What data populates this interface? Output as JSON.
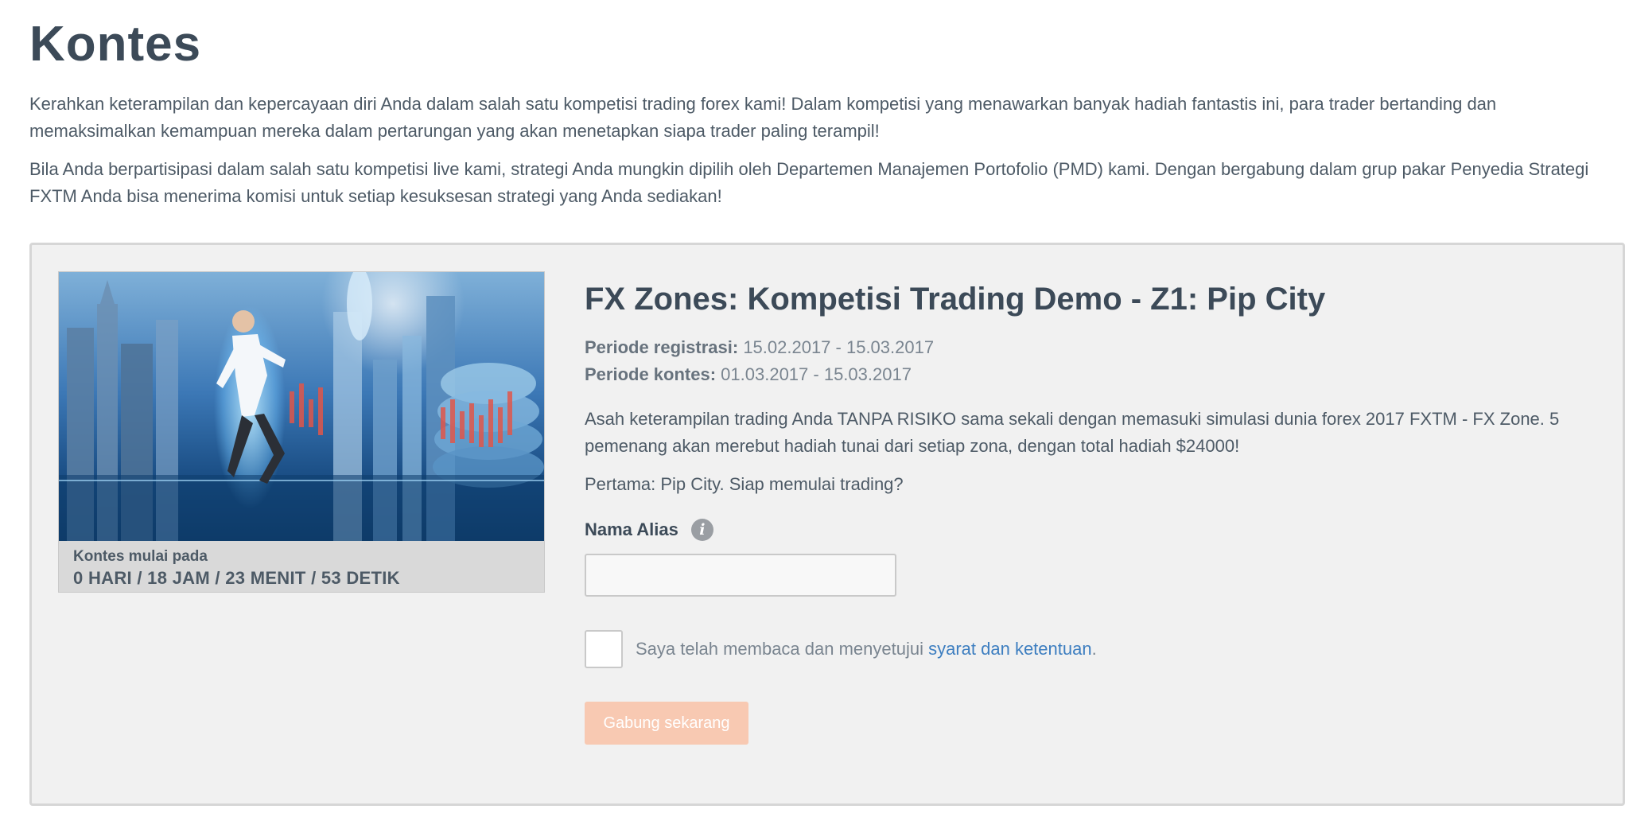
{
  "page": {
    "title": "Kontes",
    "intro_paragraphs": [
      "Kerahkan keterampilan dan kepercayaan diri Anda dalam salah satu kompetisi trading forex kami! Dalam kompetisi yang menawarkan banyak hadiah fantastis ini, para trader bertanding dan memaksimalkan kemampuan mereka dalam pertarungan yang akan menetapkan siapa trader paling terampil!",
      "Bila Anda berpartisipasi dalam salah satu kompetisi live kami, strategi Anda mungkin dipilih oleh Departemen Manajemen Portofolio (PMD) kami. Dengan bergabung dalam grup pakar Penyedia Strategi FXTM Anda bisa menerima komisi untuk setiap kesuksesan strategi yang Anda sediakan!"
    ]
  },
  "contest": {
    "banner": {
      "countdown_label": "Kontes mulai pada",
      "countdown_value": "0 HARI / 18 JAM / 23 MENIT / 53 DETIK"
    },
    "title": "FX Zones: Kompetisi Trading Demo - Z1: Pip City",
    "registration_label": "Periode registrasi:",
    "registration_value": "15.02.2017 - 15.03.2017",
    "contest_period_label": "Periode kontes:",
    "contest_period_value": "01.03.2017 - 15.03.2017",
    "description": [
      "Asah keterampilan trading Anda TANPA RISIKO sama sekali dengan memasuki simulasi dunia forex 2017 FXTM - FX Zone. 5 pemenang akan merebut hadiah tunai dari setiap zona, dengan total hadiah $24000!",
      "Pertama: Pip City. Siap memulai trading?"
    ],
    "alias_label": "Nama Alias",
    "info_icon_glyph": "i",
    "alias_value": "",
    "alias_placeholder": "",
    "agree_text": "Saya telah membaca dan menyetujui ",
    "agree_link": "syarat dan ketentuan",
    "agree_suffix": ".",
    "agree_checked": false,
    "join_button": "Gabung sekarang"
  },
  "colors": {
    "heading": "#3c4a58",
    "body_text": "#4d5a66",
    "muted_text": "#7a8590",
    "link": "#3d7ec0",
    "card_background": "#f1f1f1",
    "join_button_disabled": "#f8c9b2"
  },
  "icons": {
    "info": "info-icon"
  }
}
